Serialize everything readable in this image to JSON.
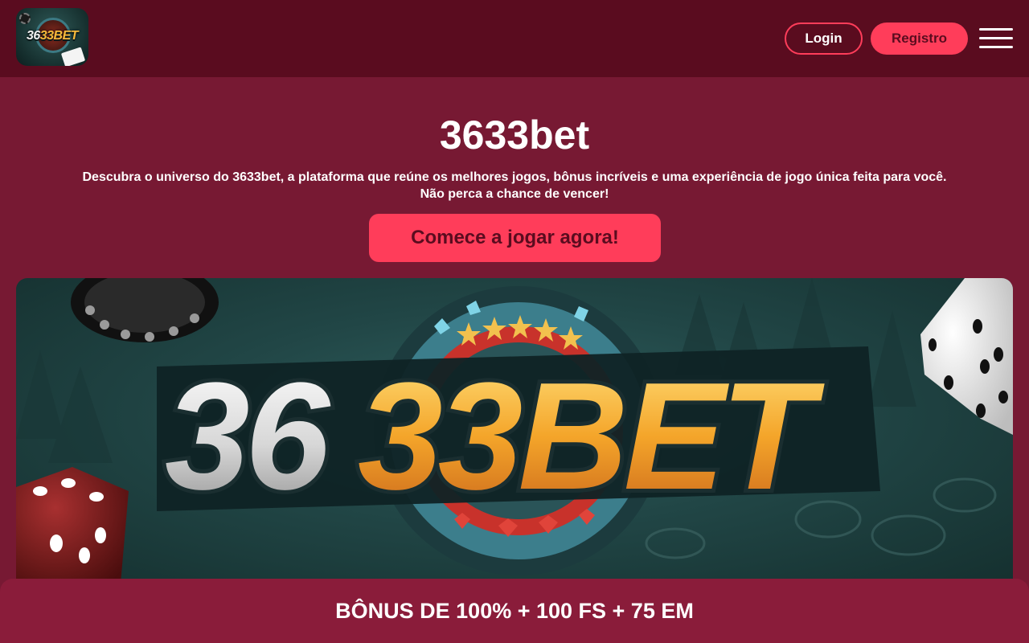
{
  "header": {
    "logo_text_white": "36",
    "logo_text_gold": "33BET",
    "login_label": "Login",
    "register_label": "Registro"
  },
  "hero": {
    "title": "3633bet",
    "description_line1": "Descubra o universo do 3633bet, a plataforma que reúne os melhores jogos, bônus incríveis e uma experiência de jogo única feita para você.",
    "description_line2": "Não perca a chance de vencer!",
    "cta_label": "Comece a jogar agora!"
  },
  "banner": {
    "logo_text_white": "36",
    "logo_text_gold": "33BET"
  },
  "bonus_bar": {
    "text": "BÔNUS DE 100% + 100 FS + 75 EM"
  },
  "colors": {
    "header_bg": "#5a0c1f",
    "page_bg": "#771933",
    "accent": "#ff3d5a",
    "bonus_bar_bg": "#8a1c3a"
  },
  "icons": [
    "hamburger-menu-icon"
  ]
}
